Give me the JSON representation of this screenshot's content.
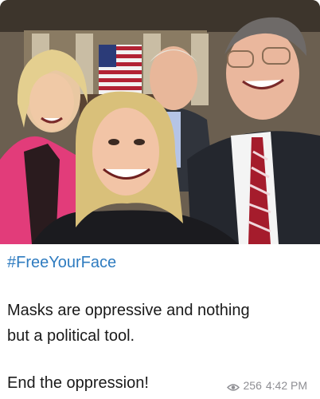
{
  "post": {
    "hashtag": "#FreeYourFace",
    "lines": [
      "Masks are oppressive and nothing",
      "but a political tool.",
      "End the oppression!"
    ],
    "views": "256",
    "time": "4:42 PM"
  },
  "icons": {
    "views_icon": "eye-icon"
  },
  "colors": {
    "hashtag": "#2f7cc0",
    "meta": "#8e8e93",
    "text": "#1a1a1a"
  }
}
